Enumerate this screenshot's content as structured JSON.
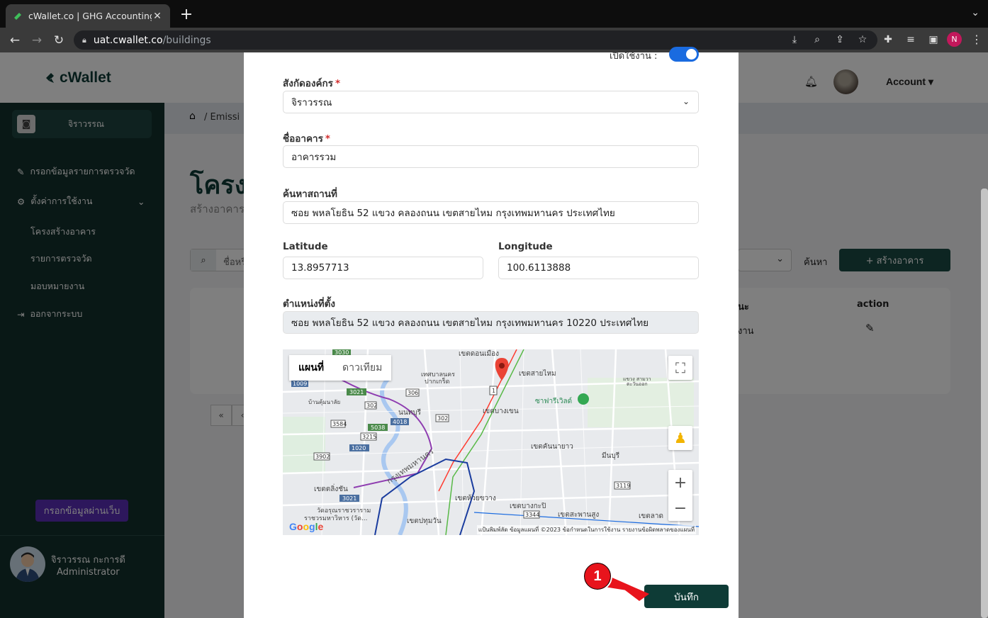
{
  "browser": {
    "tab_title": "cWallet.co | GHG Accounting S",
    "url_host": "uat.cwallet.co",
    "url_path": "/buildings",
    "profile_initial": "N"
  },
  "app": {
    "logo_text": "cWallet",
    "account_label": "Account"
  },
  "sidebar": {
    "org_name": "จิราวรรณ",
    "items": [
      {
        "label": "กรอกข้อมูลรายการตรวจวัด",
        "icon": "pencil-icon"
      },
      {
        "label": "ตั้งค่าการใช้งาน",
        "icon": "gear-icon"
      },
      {
        "label": "โครงสร้างอาคาร"
      },
      {
        "label": "รายการตรวจวัด"
      },
      {
        "label": "มอบหมายงาน"
      },
      {
        "label": "ออกจากระบบ",
        "icon": "logout-icon"
      }
    ],
    "web_button": "กรอกข้อมูลผ่านเว็บ",
    "user_name": "จิราวรรณ กะการดี",
    "user_role": "Administrator"
  },
  "main": {
    "breadcrumb": "/ Emissi",
    "title": "โครงส",
    "subtitle": "สร้างอาคาร",
    "search_placeholder": "ชื่อหรื",
    "search_button": "ค้นหา",
    "create_button": "+ สร้างอาคาร",
    "col_status": "นะ",
    "col_action": "action",
    "row_status": "งาน",
    "pager_first": "«",
    "pager_prev": "‹"
  },
  "modal": {
    "active_label": "เปิดใช้งาน :",
    "org_label": "สังกัดองค์กร",
    "org_value": "จิราวรรณ",
    "building_label": "ชื่ออาคาร",
    "building_value": "อาคารรวม",
    "search_label": "ค้นหาสถานที่",
    "search_value": "ซอย พหลโยธิน 52 แขวง คลองถนน เขตสายไหม กรุงเทพมหานคร ประเทศไทย",
    "lat_label": "Latitude",
    "lat_value": "13.8957713",
    "lng_label": "Longitude",
    "lng_value": "100.6113888",
    "location_label": "ตำแหน่งที่ตั้ง",
    "location_value": "ซอย พหลโยธิน 52 แขวง คลองถนน เขตสายไหม กรุงเทพมหานคร 10220 ประเทศไทย",
    "save_button": "บันทึก"
  },
  "map": {
    "type_map": "แผนที่",
    "type_satellite": "ดาวเทียม",
    "zoom_in": "+",
    "zoom_out": "−",
    "attribution": "แป้นพิมพ์ลัด   ข้อมูลแผนที่ ©2023   ข้อกำหนดในการใช้งาน   รายงานข้อผิดพลาดของแผนที่",
    "google": "Google",
    "places": [
      "เขตดอนเมือง",
      "เขตสายไหม",
      "เทศบาลนคร ปากเกร็ด",
      "ซาฟารีเวิลด์",
      "เขตบางเขน",
      "นนทบุรี",
      "เขตคันนายาว",
      "มีนบุรี",
      "เขตตลิ่งชัน",
      "เขตห้วยขวาง",
      "เขตบางกะปิ",
      "เขตสะพานสูง",
      "เขตปทุมวัน",
      "วัดอรุณราชวรารามราชวรมหาวิหาร (วัด...",
      "บ้านคุ้มนาลัย",
      "เขตลาด",
      "แขวง สามวา ตะวันออก",
      "กรุงเทพมหานคร",
      "นนทบุรี"
    ],
    "road_numbers": [
      "3030",
      "1009",
      "3021",
      "302",
      "306",
      "1",
      "302",
      "3584",
      "4018",
      "5038",
      "3215",
      "1020",
      "3902",
      "3021",
      "3344",
      "3119"
    ]
  },
  "annotation": {
    "step": "1"
  },
  "colors": {
    "brand": "#0e3b36",
    "sidebar": "#13302c",
    "toggle": "#1a6be0",
    "annotation": "#e8141c"
  }
}
